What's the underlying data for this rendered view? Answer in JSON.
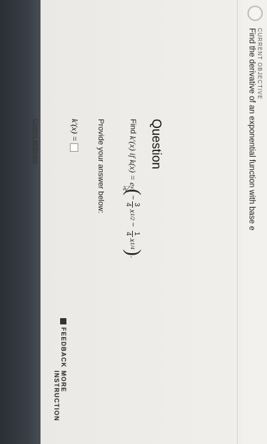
{
  "objective": {
    "label": "CURRENT OBJECTIVE",
    "title": "Find the derivative of an exponential function with base e"
  },
  "question": {
    "heading": "Question",
    "prefix": "Find",
    "func_label": "k′(x) if k(x) = e",
    "exp": "x",
    "frac1_num": "3",
    "frac1_den": "4",
    "term1": "x",
    "term1_exp": "1/2",
    "minus": "−",
    "frac2_num": "1",
    "frac2_den": "4",
    "term2": "x",
    "term2_exp": "1/4",
    "instruction": "Provide your answer below:",
    "answer_label": "k′(x) ="
  },
  "links": {
    "attribution": "Content attribution"
  },
  "buttons": {
    "feedback": "FEEDBACK",
    "more": "MORE INSTRUCTION"
  }
}
